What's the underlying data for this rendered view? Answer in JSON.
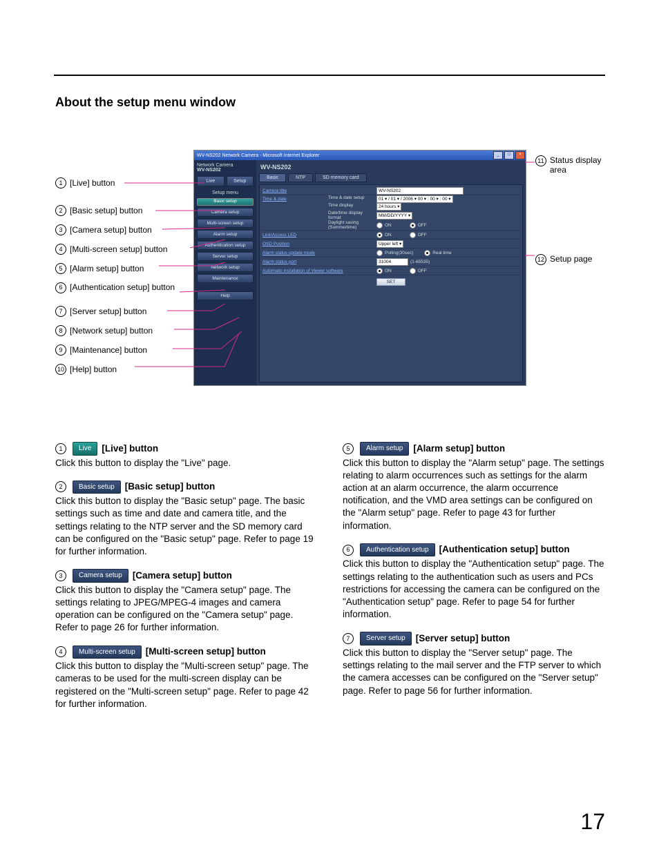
{
  "heading": "About the setup menu window",
  "page_number": "17",
  "callouts": {
    "left": [
      {
        "n": "1",
        "label": "[Live] button"
      },
      {
        "n": "2",
        "label": "[Basic setup] button"
      },
      {
        "n": "3",
        "label": "[Camera setup] button"
      },
      {
        "n": "4",
        "label": "[Multi-screen setup] button"
      },
      {
        "n": "5",
        "label": "[Alarm setup] button"
      },
      {
        "n": "6",
        "label": "[Authentication setup] button"
      },
      {
        "n": "7",
        "label": "[Server setup] button"
      },
      {
        "n": "8",
        "label": "[Network setup] button"
      },
      {
        "n": "9",
        "label": "[Maintenance] button"
      },
      {
        "n": "10",
        "label": "[Help] button"
      }
    ],
    "right": [
      {
        "n": "11",
        "label": "Status display area"
      },
      {
        "n": "12",
        "label": "Setup page"
      }
    ]
  },
  "window": {
    "title": "WV-NS202 Network Camera - Microsoft Internet Explorer",
    "model": "WV-NS202",
    "model_sub": "Network Camera",
    "top_buttons": {
      "live": "Live",
      "setup": "Setup"
    },
    "side_header": "Setup menu",
    "side_items": {
      "basic": "Basic setup",
      "camera": "Camera setup",
      "multi": "Multi-screen setup",
      "alarm": "Alarm setup",
      "auth": "Authentication setup",
      "server": "Server setup",
      "network": "Network setup",
      "maint": "Maintenance",
      "help": "Help"
    },
    "tabs": {
      "basic": "Basic",
      "ntp": "NTP",
      "sd": "SD memory card"
    },
    "rows": {
      "camera_title": {
        "label": "Camera title",
        "value": "WV-NS202"
      },
      "time_date": {
        "label": "Time & date",
        "sub1": "Time & date setup",
        "v1": "01 ▾ / 01 ▾ / 2006 ▾   00 ▾ : 00 ▾ : 00 ▾",
        "sub2": "Time display",
        "v2": "24 hours ▾",
        "sub3": "Date/time display format",
        "v3": "MM/DD/YYYY ▾",
        "sub4": "Daylight saving (Summertime)",
        "on": "ON",
        "off": "OFF"
      },
      "link_led": {
        "label": "Link/Access LED",
        "on": "ON",
        "off": "OFF"
      },
      "osd": {
        "label": "OSD Position",
        "value": "Upper left ▾"
      },
      "alarm_mode": {
        "label": "Alarm status update mode",
        "polling": "Polling(30sec)",
        "real": "Real time"
      },
      "alarm_port": {
        "label": "Alarm status port",
        "value": "31004",
        "hint": "(1-65535)"
      },
      "auto_install": {
        "label": "Automatic installation of Viewer software",
        "on": "ON",
        "off": "OFF"
      }
    },
    "set": "SET"
  },
  "items": [
    {
      "n": "1",
      "pill": "Live",
      "title": "[Live] button",
      "body": "Click this button to display the \"Live\" page."
    },
    {
      "n": "2",
      "pill": "Basic setup",
      "title": "[Basic setup] button",
      "body": "Click this button to display the \"Basic setup\" page. The basic settings such as time and date and camera title, and the settings relating to the NTP server and the SD memory card can be configured on the \"Basic setup\" page. Refer to page 19 for further information."
    },
    {
      "n": "3",
      "pill": "Camera setup",
      "title": "[Camera setup] button",
      "body": "Click this button to display the \"Camera setup\" page. The settings relating to JPEG/MPEG-4 images and camera operation can be configured on the \"Camera setup\" page. Refer to page 26 for further information."
    },
    {
      "n": "4",
      "pill": "Multi-screen setup",
      "title": "[Multi-screen setup] button",
      "body": "Click this button to display the \"Multi-screen setup\" page. The cameras to be used for the multi-screen display can be registered on the \"Multi-screen setup\" page. Refer to page 42 for further information."
    },
    {
      "n": "5",
      "pill": "Alarm setup",
      "title": "[Alarm setup] button",
      "body": "Click this button to display the \"Alarm setup\" page. The settings relating to alarm occurrences such as settings for the alarm action at an alarm occurrence, the alarm occurrence notification, and the VMD area settings can be configured on the \"Alarm setup\" page. Refer to page 43 for further information."
    },
    {
      "n": "6",
      "pill": "Authentication setup",
      "title": "[Authentication setup] button",
      "body": "Click this button to display the \"Authentication setup\" page. The settings relating to the authentication such as users and PCs restrictions for accessing the camera can be configured on the \"Authentication setup\" page. Refer to page 54 for further information."
    },
    {
      "n": "7",
      "pill": "Server setup",
      "title": "[Server setup] button",
      "body": "Click this button to display the \"Server setup\" page. The settings relating to the mail server and the FTP server to which the camera accesses can be configured on the \"Server setup\" page. Refer to page 56 for further information."
    }
  ]
}
